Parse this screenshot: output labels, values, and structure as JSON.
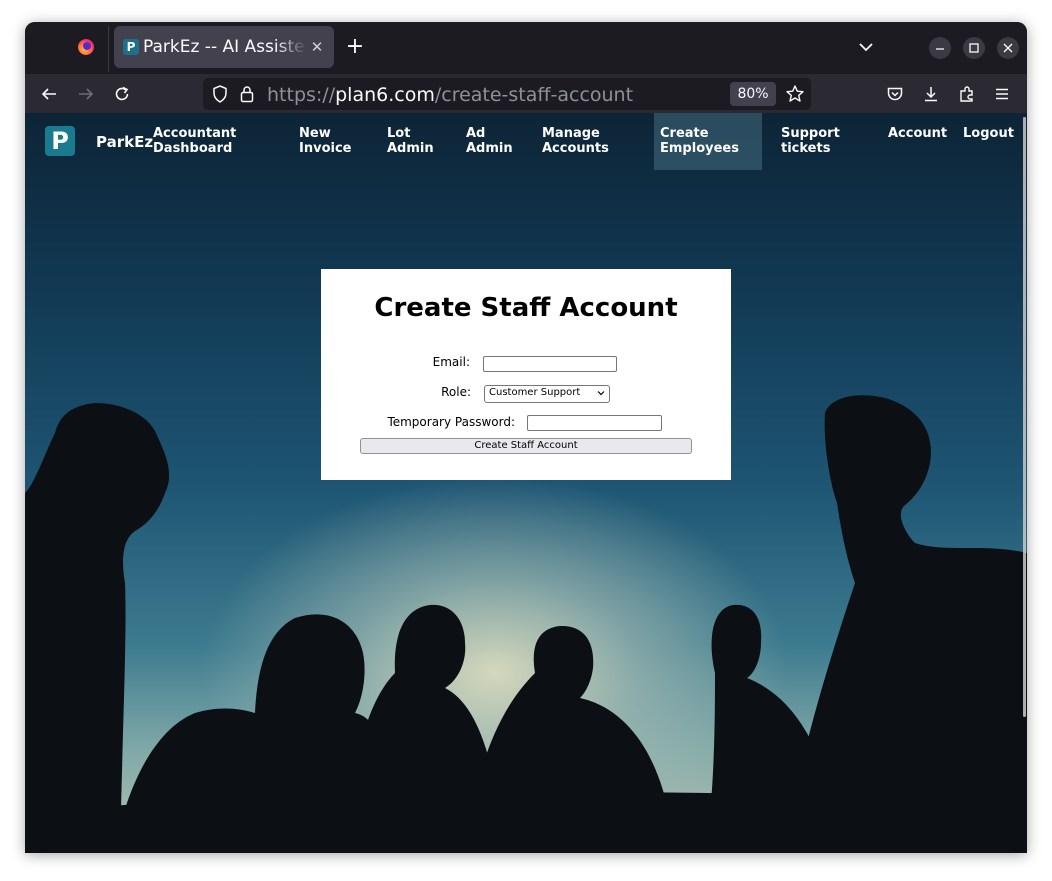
{
  "browser": {
    "tab_title": "ParkEz -- AI Assistec",
    "tab_favicon": "P",
    "url_scheme": "https://",
    "url_host": "plan6.com",
    "url_path": "/create-staff-account",
    "zoom": "80%"
  },
  "site": {
    "logo_letter": "P",
    "brand": "ParkEz",
    "nav": [
      {
        "line1": "Accountant",
        "line2": "Dashboard"
      },
      {
        "line1": "New",
        "line2": "Invoice"
      },
      {
        "line1": "Lot",
        "line2": "Admin"
      },
      {
        "line1": "Ad",
        "line2": "Admin"
      },
      {
        "line1": "Manage",
        "line2": "Accounts"
      },
      {
        "line1": "Create",
        "line2": "Employees"
      },
      {
        "line1": "Support",
        "line2": "tickets"
      },
      {
        "line1": "Account",
        "line2": ""
      },
      {
        "line1": "Logout",
        "line2": ""
      }
    ],
    "active_nav": "Create Employees"
  },
  "form": {
    "title": "Create Staff Account",
    "email_label": "Email:",
    "email_value": "",
    "role_label": "Role:",
    "role_value": "Customer Support",
    "password_label": "Temporary Password:",
    "password_value": "",
    "submit_label": "Create Staff Account"
  },
  "colors": {
    "brand_teal": "#1a7a8f",
    "browser_chrome": "#2b2a33"
  }
}
